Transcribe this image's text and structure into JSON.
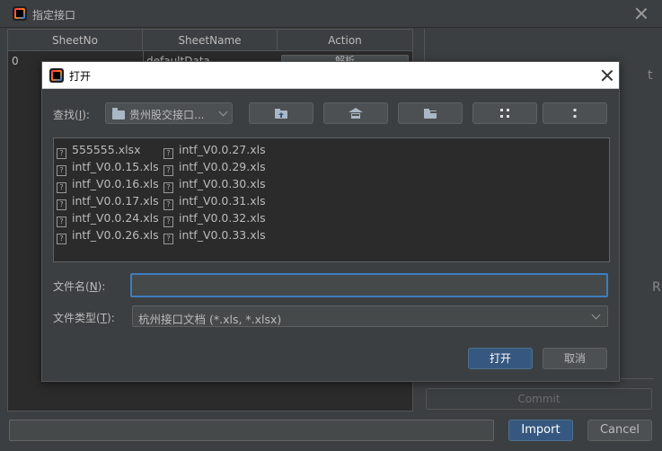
{
  "window": {
    "title": "指定接口",
    "close_icon": "close-icon"
  },
  "table": {
    "columns": [
      "SheetNo",
      "SheetName",
      "Action"
    ],
    "rows": [
      {
        "sheet_no": "0",
        "sheet_name": "defaultData",
        "action": "解析"
      }
    ]
  },
  "side": {
    "letter_top": "t",
    "letter_mid": "R",
    "commit_label": "Commit"
  },
  "bottom": {
    "path_value": "",
    "import_label": "Import",
    "cancel_label": "Cancel"
  },
  "dialog": {
    "title": "打开",
    "lookin_label_prefix": "查找(",
    "lookin_label_key": "I",
    "lookin_label_suffix": "):",
    "lookin_value": "贵州股交接口...",
    "toolbar": [
      {
        "name": "up-folder-button",
        "icon": "up-folder-icon"
      },
      {
        "name": "home-button",
        "icon": "home-icon"
      },
      {
        "name": "new-folder-button",
        "icon": "new-folder-icon"
      },
      {
        "name": "list-view-button",
        "icon": "list-view-icon"
      },
      {
        "name": "details-view-button",
        "icon": "details-view-icon"
      }
    ],
    "files_col1": [
      "555555.xlsx",
      "intf_V0.0.15.xls",
      "intf_V0.0.16.xls",
      "intf_V0.0.17.xls",
      "intf_V0.0.24.xls",
      "intf_V0.0.26.xls"
    ],
    "files_col2": [
      "intf_V0.0.27.xls",
      "intf_V0.0.29.xls",
      "intf_V0.0.30.xls",
      "intf_V0.0.31.xls",
      "intf_V0.0.32.xls",
      "intf_V0.0.33.xls"
    ],
    "file_icon_glyph": "?",
    "filename_label_prefix": "文件名(",
    "filename_label_key": "N",
    "filename_label_suffix": "):",
    "filename_value": "",
    "filetype_label_prefix": "文件类型(",
    "filetype_label_key": "T",
    "filetype_label_suffix": "):",
    "filetype_value": "杭州接口文档 (*.xls, *.xlsx)",
    "open_label": "打开",
    "cancel_label": "取消"
  },
  "colors": {
    "accent": "#365880",
    "focus": "#3d7ebf",
    "background": "#3c3f41"
  }
}
